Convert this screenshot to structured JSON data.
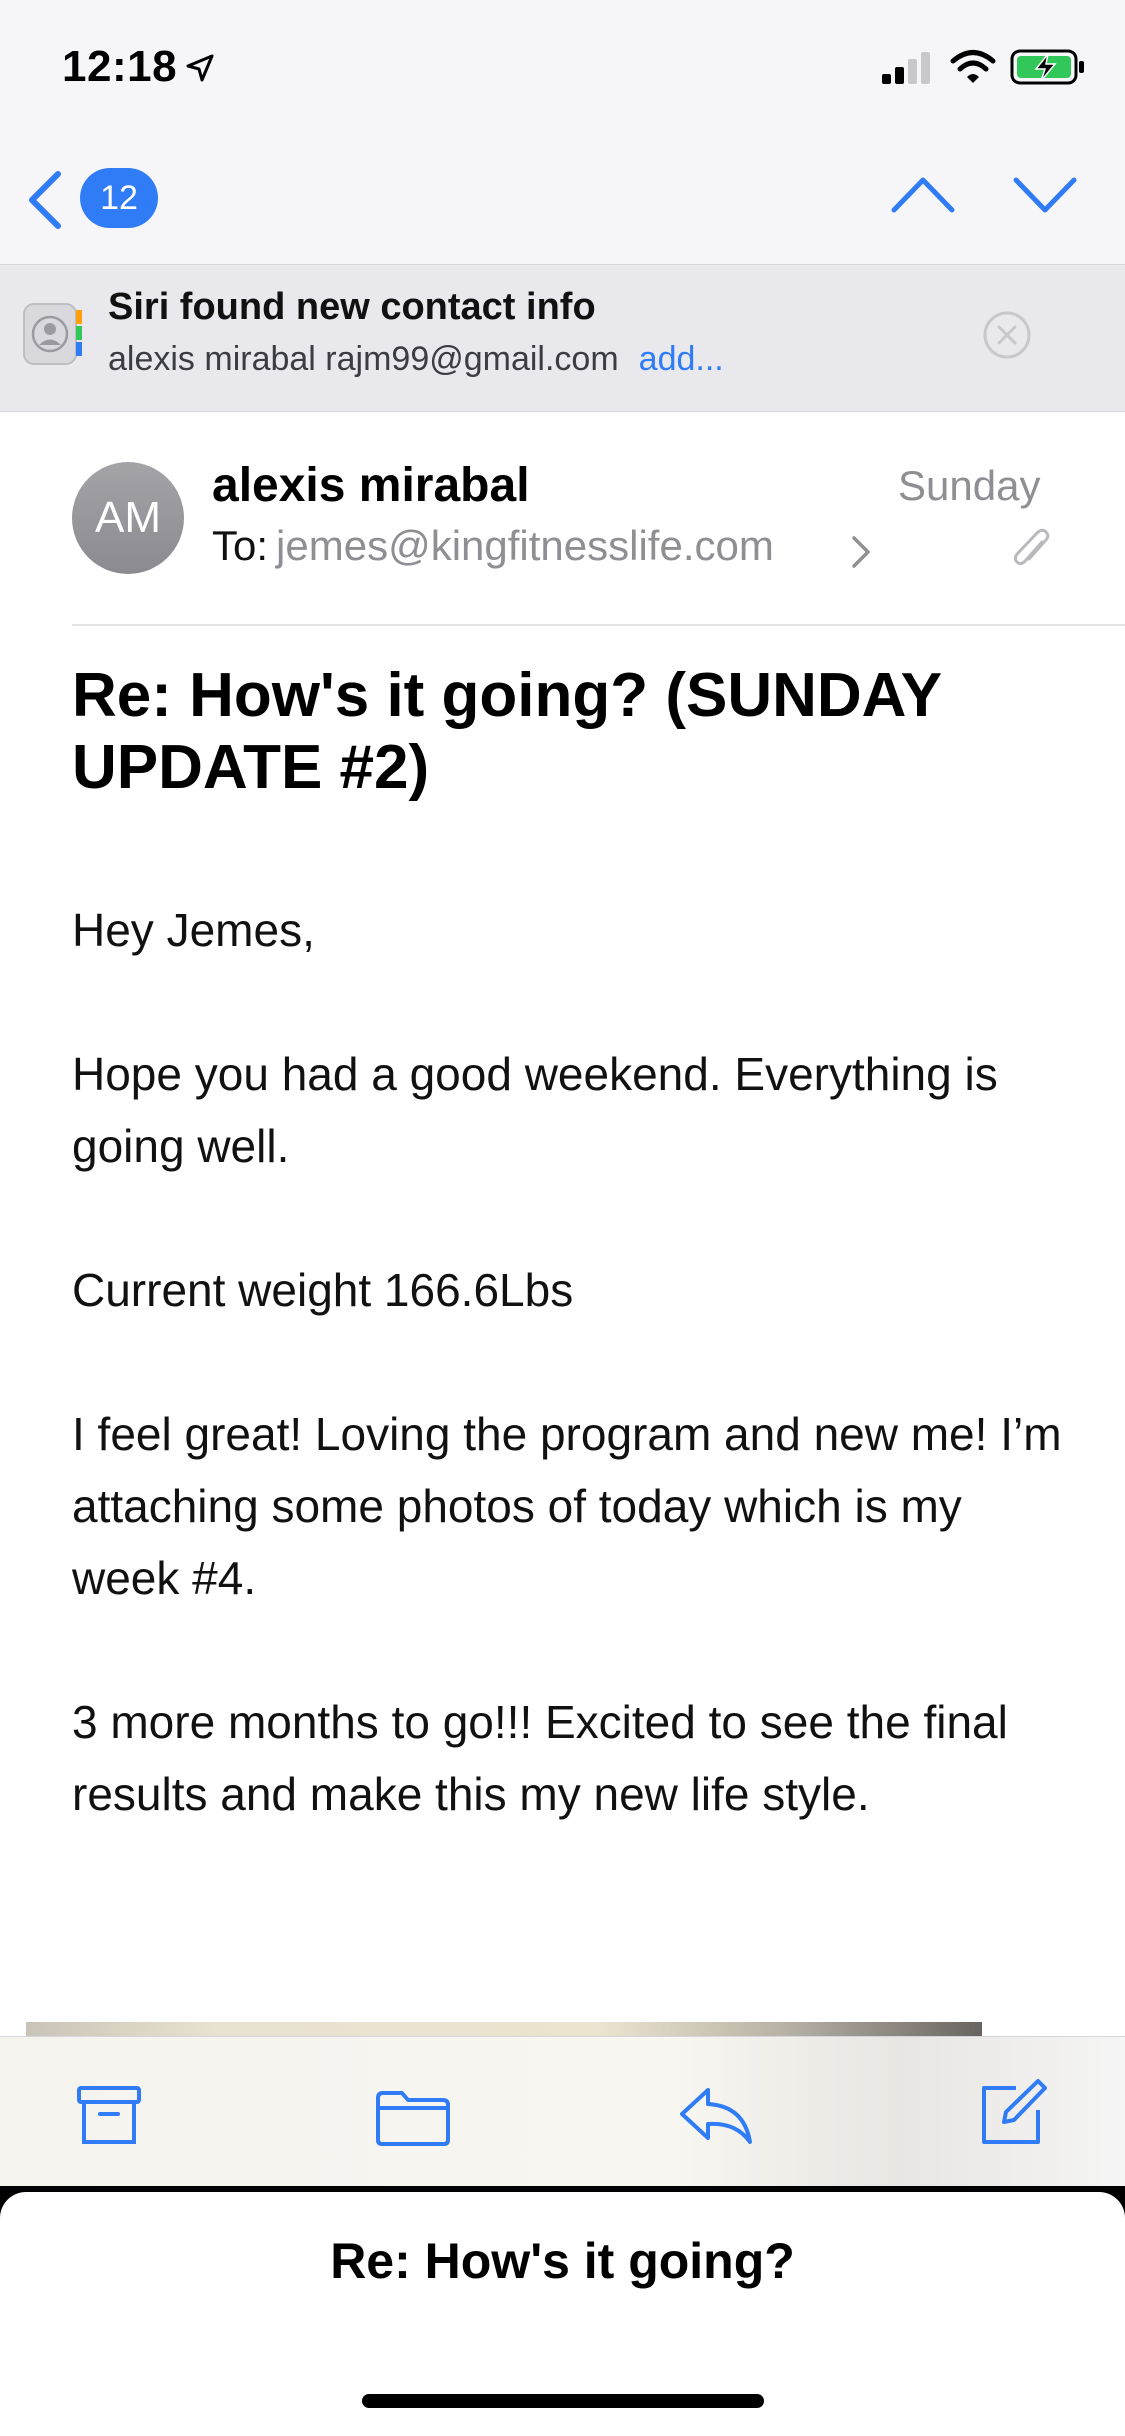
{
  "status_bar": {
    "time": "12:18",
    "icons": [
      "location-arrow-icon",
      "cellular-signal-icon",
      "wifi-icon",
      "battery-charging-icon"
    ]
  },
  "nav": {
    "back_badge": "12",
    "prev_icon": "chevron-up-icon",
    "next_icon": "chevron-down-icon"
  },
  "siri_banner": {
    "title": "Siri found new contact info",
    "contact": "alexis mirabal rajm99@gmail.com",
    "add_link": "add..."
  },
  "message": {
    "avatar_initials": "AM",
    "sender": "alexis mirabal",
    "date": "Sunday",
    "to_label": "To:",
    "to_address": "jemes@kingfitnesslife.com",
    "subject": "Re:  How's it going? (SUNDAY UPDATE #2)",
    "body": {
      "greeting": "Hey Jemes,",
      "p1": "Hope you had a good weekend. Everything is going well.",
      "p2": "Current weight 166.6Lbs",
      "p3": "I feel great! Loving the program and new me! I’m attaching some photos of today which is my week #4.",
      "p4": "3 more months to go!!! Excited to see the final results and make this my new life style."
    }
  },
  "toolbar": {
    "icons": [
      "archive-icon",
      "folder-icon",
      "reply-icon",
      "compose-icon"
    ]
  },
  "draft": {
    "title": "Re: How's it going?"
  },
  "colors": {
    "accent": "#2f7cf6",
    "secondary_text": "#8e8e93",
    "banner_bg": "#e8e8ed"
  }
}
